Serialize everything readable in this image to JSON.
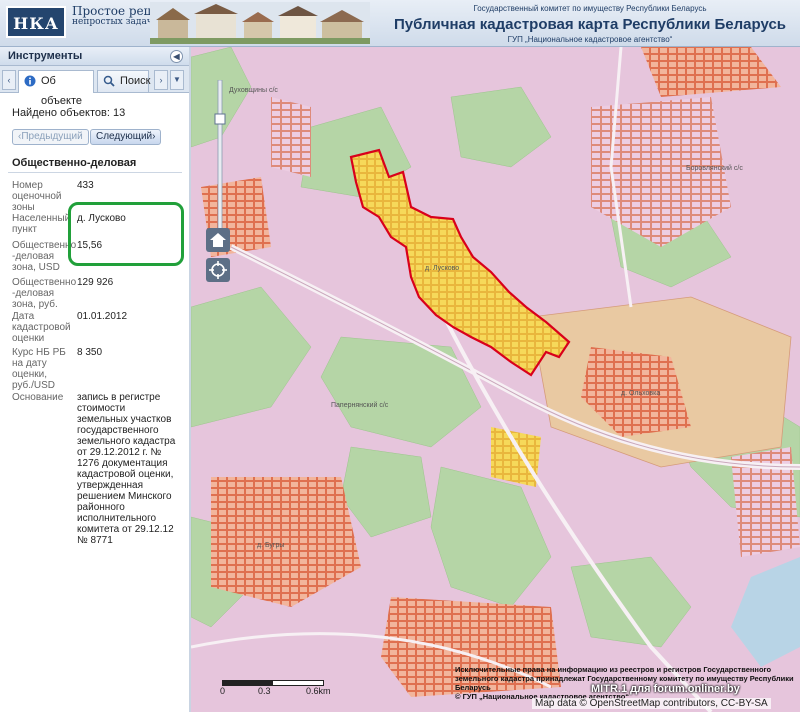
{
  "header": {
    "logo_text": "НКА",
    "slogan_line1": "Простое решение",
    "slogan_line2": "непростых задач",
    "gov_line1": "Государственный комитет по имуществу Республики Беларусь",
    "title": "Публичная кадастровая карта Республики Беларусь",
    "gov_line3": "ГУП „Национальное кадастровое агентство“"
  },
  "panel": {
    "title": "Инструменты",
    "tabs": [
      {
        "label": "Об объекте",
        "icon": "info-icon",
        "active": true
      },
      {
        "label": "Поиск",
        "icon": "search-icon",
        "active": false
      }
    ],
    "found_text": "Найдено объектов: 13",
    "prev_label": "‹Предыдущий",
    "next_label": "Следующий›",
    "section_title": "Общественно-деловая",
    "attributes": [
      {
        "label": "Номер оценочной зоны",
        "value": "433"
      },
      {
        "label": "Населенный пункт",
        "value": "д. Лусково"
      },
      {
        "label": "Общественно -деловая зона, USD",
        "value": "15,56"
      },
      {
        "label": "Общественно -деловая зона, руб.",
        "value": "129 926"
      },
      {
        "label": "Дата кадастровой оценки",
        "value": "01.01.2012"
      },
      {
        "label": "Курс НБ РБ на дату оценки, руб./USD",
        "value": "8 350"
      },
      {
        "label": "Основание",
        "value": "запись в регистре стоимости земельных участков государственного земельного кадастра от 29.12.2012 г. № 1276 документация кадастровой оценки, утвержденная решением Минского районного исполнительного комитета от 29.12.12 № 8771"
      }
    ]
  },
  "map": {
    "labels": {
      "l1": "Духовщины с/с",
      "l2": "Папернянский с/с",
      "l3": "Боровлянский с/с",
      "l4": "д. Лусково",
      "l5": "д. Ольховка",
      "l6": "д. Бугры"
    },
    "attribution": "Исключительные права на информацию из реестров и регистров Государственного земельного кадастра принадлежат Государственному комитету по имуществу Республики Беларусь",
    "attribution2": "© ГУП „Национальное кадастровое агентство“",
    "osm_text": "Map data © OpenStreetMap contributors, CC-BY-SA",
    "watermark": "MITR.1 для forum.onliner.by",
    "scale_labels": [
      "0",
      "0.3",
      "0.6km"
    ],
    "colors": {
      "base": "#e7c8de",
      "forest": "#b6d6a8",
      "selected_zone": "#f7d64a",
      "selected_border": "#d9001b",
      "parcels": "#f4b9a0"
    }
  }
}
